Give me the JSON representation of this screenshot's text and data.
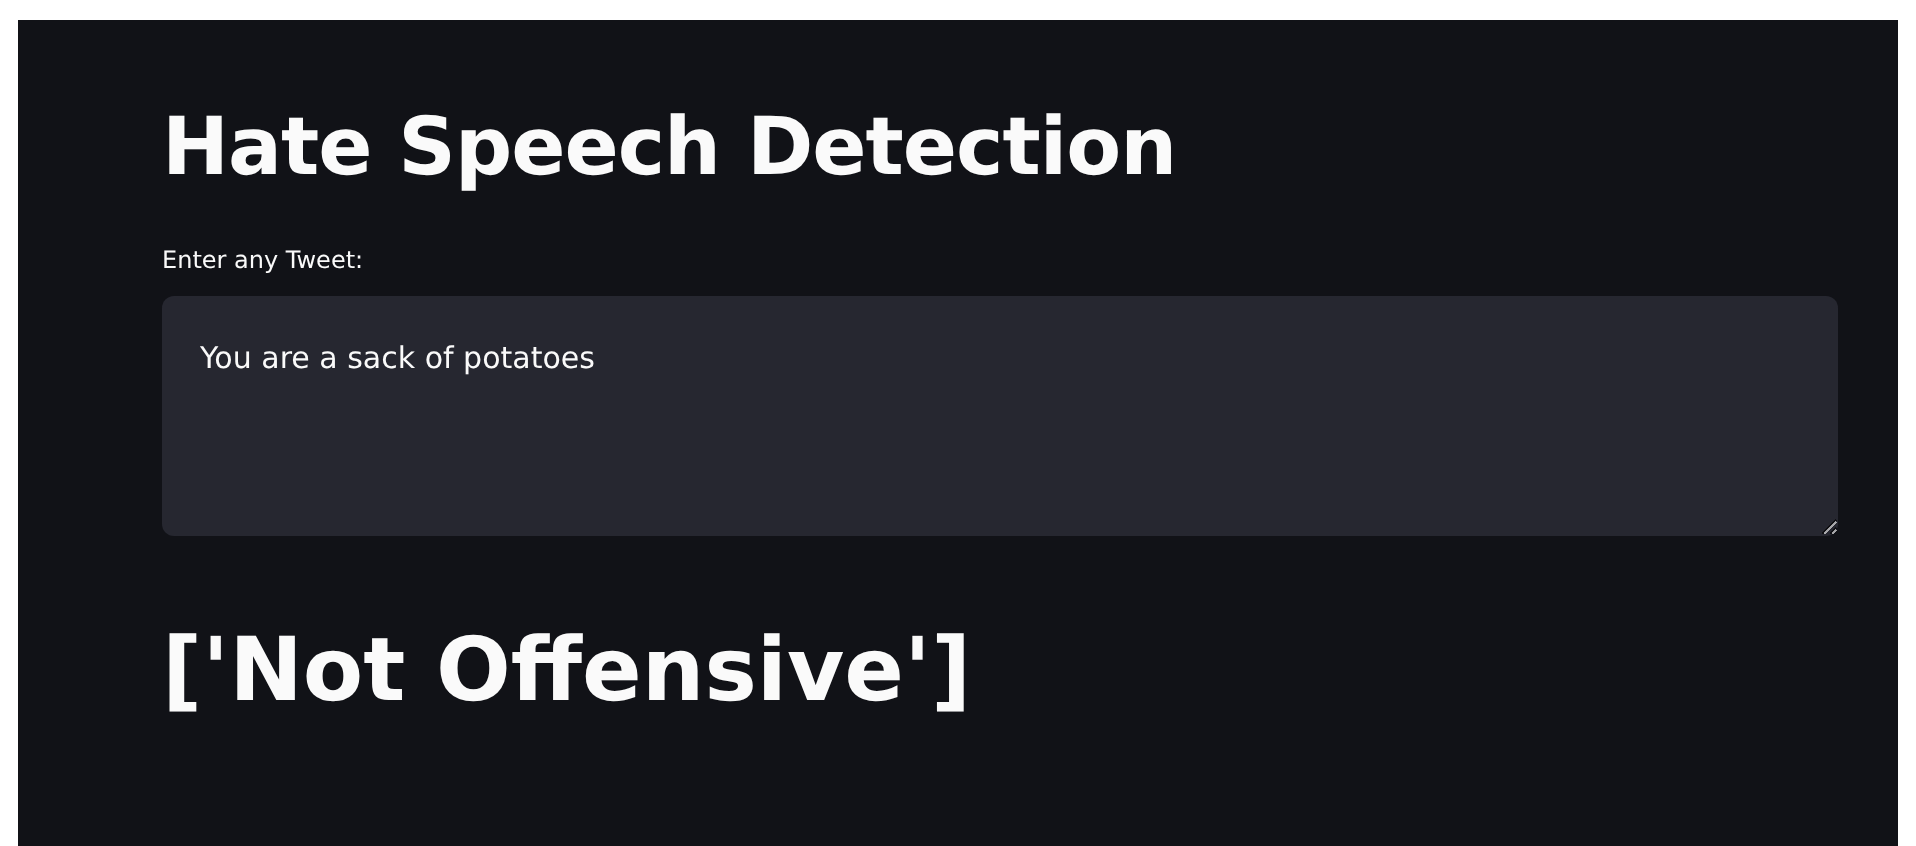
{
  "title": "Hate Speech Detection",
  "tweet_field": {
    "label": "Enter any Tweet:",
    "value": "You are a sack of potatoes"
  },
  "result": "['Not Offensive']"
}
